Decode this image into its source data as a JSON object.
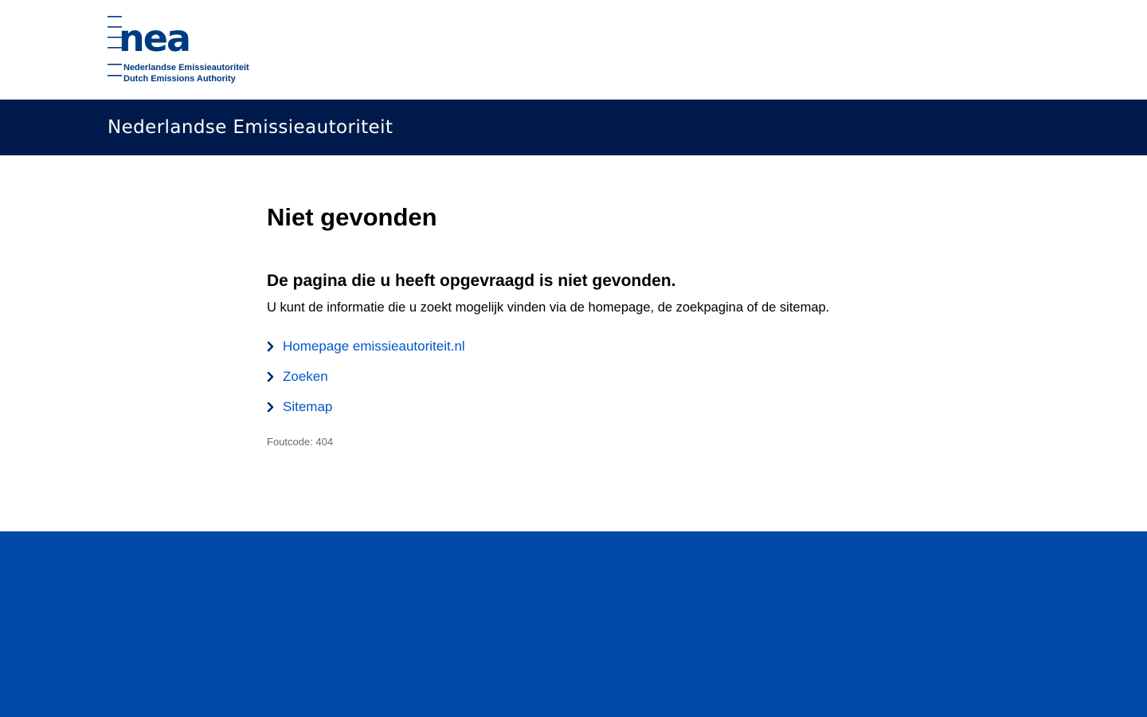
{
  "logo": {
    "mark": "nea",
    "line1": "Nederlandse Emissieautoriteit",
    "line2": "Dutch Emissions Authority"
  },
  "header": {
    "site_title": "Nederlandse Emissieautoriteit"
  },
  "main": {
    "title": "Niet gevonden",
    "subheading": "De pagina die u heeft opgevraagd is niet gevonden.",
    "intro": "U kunt de informatie die u zoekt mogelijk vinden via de homepage, de zoekpagina of de sitemap.",
    "links": [
      {
        "label": "Homepage emissieautoriteit.nl",
        "icon": "chevron-right-icon"
      },
      {
        "label": "Zoeken",
        "icon": "chevron-right-icon"
      },
      {
        "label": "Sitemap",
        "icon": "chevron-right-icon"
      }
    ],
    "error_code": "Foutcode: 404"
  },
  "colors": {
    "title_bar": "#001b4b",
    "footer": "#0049a8",
    "link": "#0057c8",
    "logo": "#003a80"
  }
}
